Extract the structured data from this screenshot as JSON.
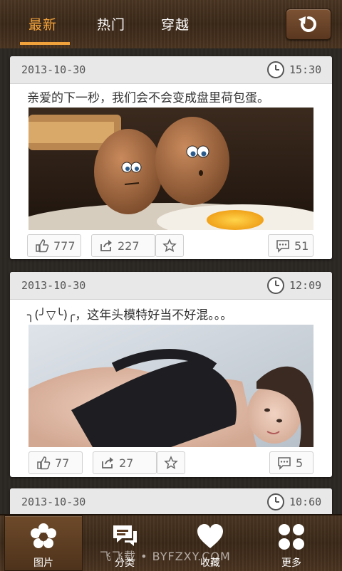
{
  "header": {
    "tabs": [
      {
        "label": "最新",
        "active": true
      },
      {
        "label": "热门",
        "active": false
      },
      {
        "label": "穿越",
        "active": false
      }
    ],
    "refresh_icon": "refresh-icon",
    "accent_color": "#f2a23a"
  },
  "feed": {
    "posts": [
      {
        "date": "2013-10-30",
        "time": "15:30",
        "caption": "亲爱的下一秒，我们会不会变成盘里荷包蛋。",
        "image": "two-eggs-with-faces-beside-fried-egg",
        "likes": "777",
        "shares": "227",
        "comments": "51"
      },
      {
        "date": "2013-10-30",
        "time": "12:09",
        "caption": "╮(╯▽╰)╭，这年头模特好当不好混。。。",
        "image": "woman-lying-on-bed",
        "likes": "77",
        "shares": "27",
        "comments": "5"
      },
      {
        "date": "2013-10-30",
        "time": "10:60"
      }
    ]
  },
  "bottom_nav": {
    "items": [
      {
        "label": "图片",
        "icon": "flower-icon",
        "active": true
      },
      {
        "label": "分类",
        "icon": "speech-bubbles-icon",
        "active": false
      },
      {
        "label": "收藏",
        "icon": "heart-icon",
        "active": false
      },
      {
        "label": "更多",
        "icon": "four-dots-icon",
        "active": false
      }
    ]
  },
  "watermark": "飞飞载 • BYFZXY.COM"
}
